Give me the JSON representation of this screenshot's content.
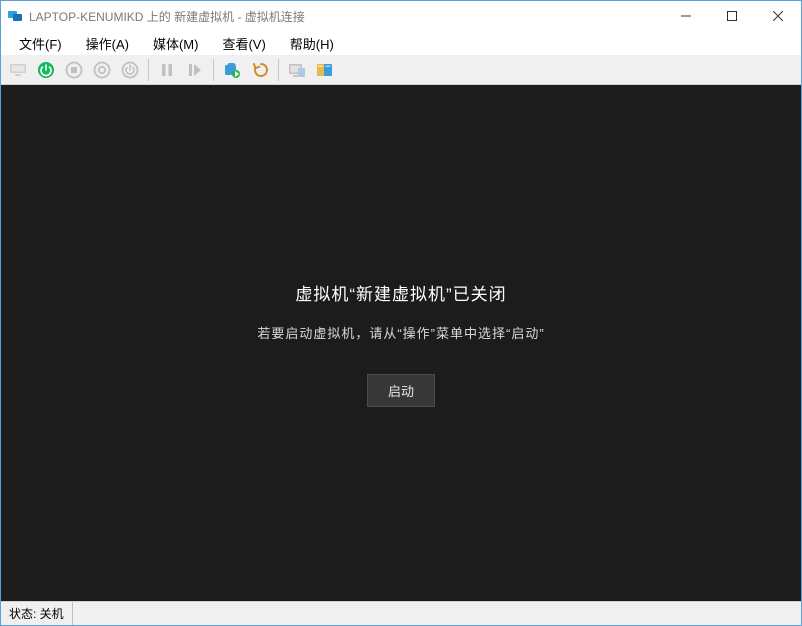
{
  "window": {
    "title": "LAPTOP-KENUMIKD 上的 新建虚拟机 - 虚拟机连接"
  },
  "menu": {
    "file": "文件(F)",
    "action": "操作(A)",
    "media": "媒体(M)",
    "view": "查看(V)",
    "help": "帮助(H)"
  },
  "toolbar": {
    "ctrl_alt_del": "Ctrl+Alt+Del",
    "start": "启动",
    "turn_off": "关闭",
    "shutdown": "关机",
    "save": "保存",
    "pause": "暂停",
    "reset": "重置",
    "checkpoint": "检查点",
    "revert": "还原",
    "enhanced": "增强会话",
    "share": "共享"
  },
  "viewport": {
    "heading": "虚拟机“新建虚拟机”已关闭",
    "subtext": "若要启动虚拟机，请从“操作”菜单中选择“启动”",
    "button": "启动"
  },
  "status": {
    "label": "状态: 关机"
  }
}
